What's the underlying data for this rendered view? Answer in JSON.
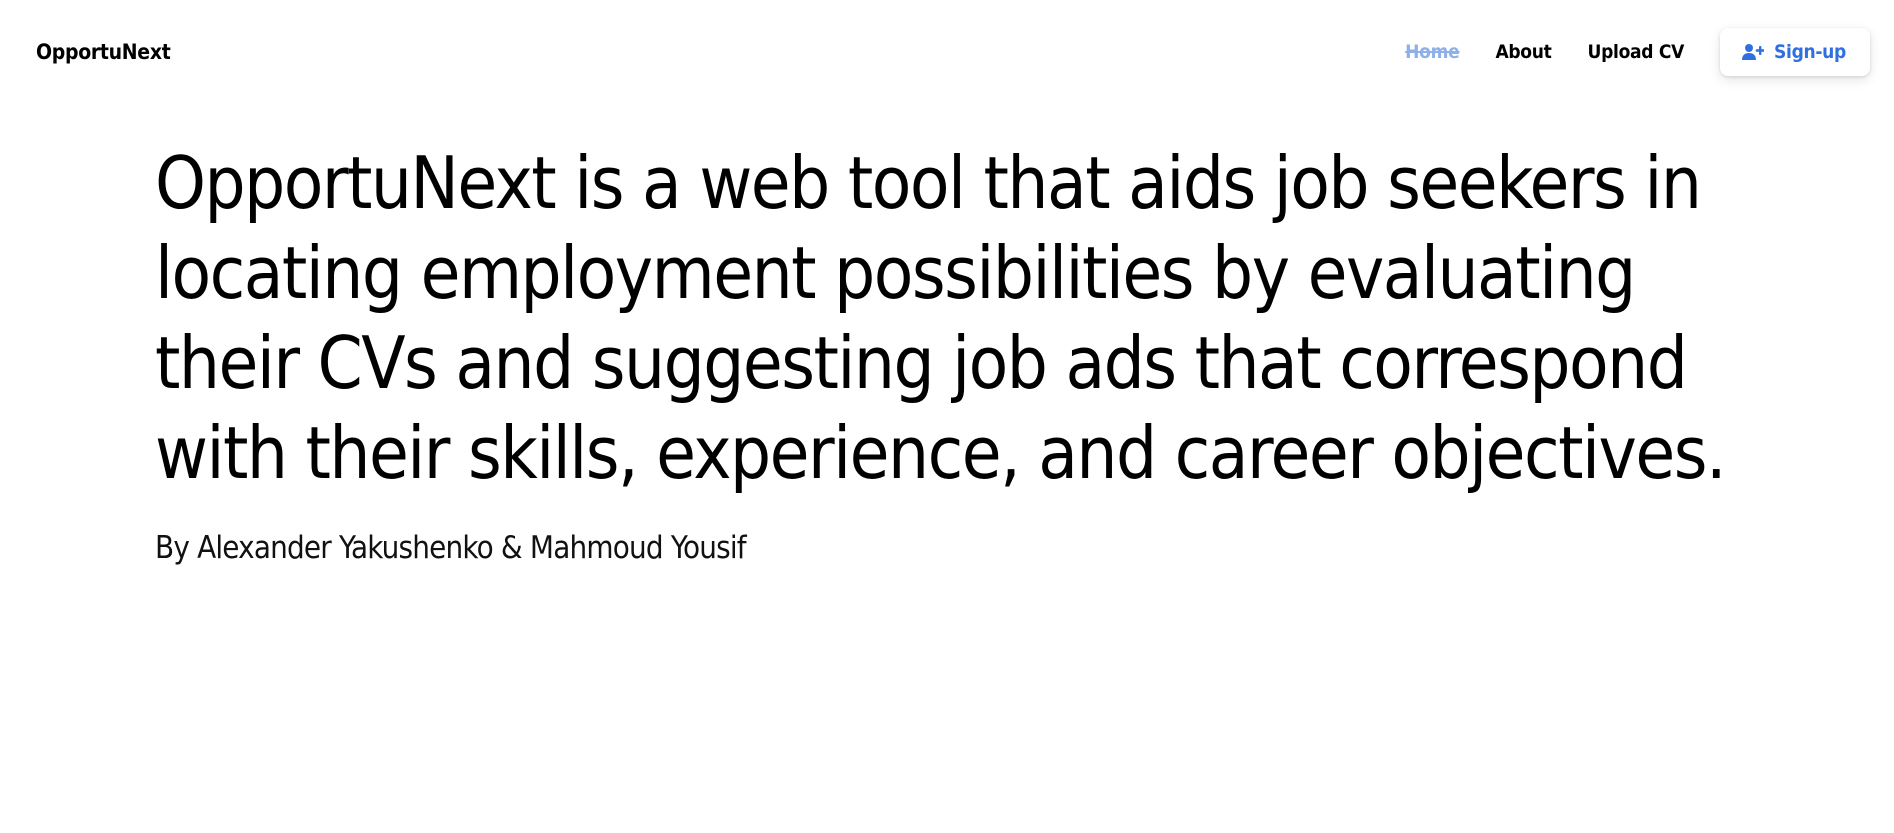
{
  "navbar": {
    "brand": "OpportuNext",
    "links": [
      {
        "label": "Home",
        "active": true
      },
      {
        "label": "About",
        "active": false
      },
      {
        "label": "Upload CV",
        "active": false
      }
    ],
    "signup": {
      "label": "Sign-up",
      "icon": "user-plus-icon"
    }
  },
  "hero": {
    "title": "OpportuNext is a web tool that aids job seekers in locating employment possibilities by evaluating their CVs and suggesting job ads that correspond with their skills, experience, and career objectives.",
    "byline": "By Alexander Yakushenko & Mahmoud Yousif"
  },
  "colors": {
    "accent": "#2f6fe0",
    "active_link": "#8fb0e8",
    "text": "#000000",
    "background": "#ffffff"
  }
}
